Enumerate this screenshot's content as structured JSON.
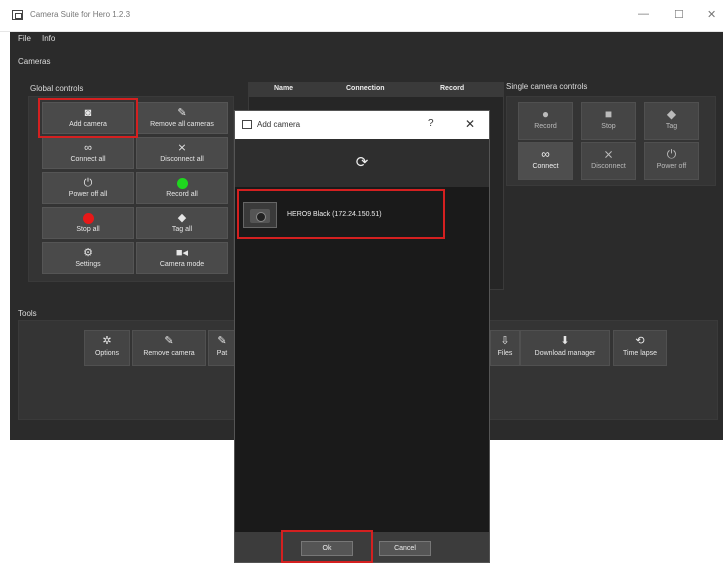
{
  "window": {
    "title": "Camera Suite for Hero 1.2.3",
    "minimize": "—",
    "maximize": "☐",
    "close": "✕"
  },
  "menu": {
    "file": "File",
    "info": "Info"
  },
  "cameras_label": "Cameras",
  "global": {
    "title": "Global controls",
    "buttons": [
      {
        "label": "Add camera",
        "icon": "camera-icon",
        "glyph": "📷"
      },
      {
        "label": "Remove all cameras",
        "icon": "brush-icon",
        "glyph": "✎"
      },
      {
        "label": "Connect all",
        "icon": "link-icon",
        "glyph": "🔗"
      },
      {
        "label": "Disconnect all",
        "icon": "unlink-icon",
        "glyph": "✂"
      },
      {
        "label": "Power off all",
        "icon": "power-icon",
        "glyph": "⏻"
      },
      {
        "label": "Record all",
        "icon": "record-green-dot-icon",
        "glyph": ""
      },
      {
        "label": "Stop all",
        "icon": "stop-red-dot-icon",
        "glyph": ""
      },
      {
        "label": "Tag all",
        "icon": "tag-icon",
        "glyph": "🏷"
      },
      {
        "label": "Settings",
        "icon": "settings-icon",
        "glyph": "⚙"
      },
      {
        "label": "Camera mode",
        "icon": "video-icon",
        "glyph": "🎥"
      }
    ],
    "colors": {
      "record": "#1fd61f",
      "stop": "#e81818"
    }
  },
  "table": {
    "headers": [
      "Name",
      "Connection",
      "Record"
    ]
  },
  "single": {
    "title": "Single camera controls",
    "buttons": [
      {
        "label": "Record",
        "icon": "record-icon",
        "glyph": "⏺"
      },
      {
        "label": "Stop",
        "icon": "stop-icon",
        "glyph": "■"
      },
      {
        "label": "Tag",
        "icon": "tag-icon",
        "glyph": "🏷"
      },
      {
        "label": "Connect",
        "icon": "link-icon",
        "glyph": "🔗"
      },
      {
        "label": "Disconnect",
        "icon": "unlink-icon",
        "glyph": "✂"
      },
      {
        "label": "Power off",
        "icon": "power-icon",
        "glyph": "⏻"
      }
    ]
  },
  "tools": {
    "title": "Tools",
    "buttons": [
      {
        "label": "Options",
        "icon": "gear-icon",
        "glyph": "✲"
      },
      {
        "label": "Remove camera",
        "icon": "brush-icon",
        "glyph": "✎"
      },
      {
        "label": "Pat",
        "icon": "partial-icon",
        "glyph": "✎"
      },
      {
        "label": "Files",
        "icon": "file-icon",
        "glyph": "⇩"
      },
      {
        "label": "Download manager",
        "icon": "download-icon",
        "glyph": "⬇"
      },
      {
        "label": "Time lapse",
        "icon": "timelapse-icon",
        "glyph": "⟲"
      }
    ]
  },
  "dialog": {
    "title": "Add camera",
    "help": "?",
    "close": "✕",
    "refresh_glyph": "⟳",
    "camera_item": "HERO9 Black (172.24.150.51)",
    "ok": "Ok",
    "cancel": "Cancel"
  },
  "highlight_color": "#d42020"
}
